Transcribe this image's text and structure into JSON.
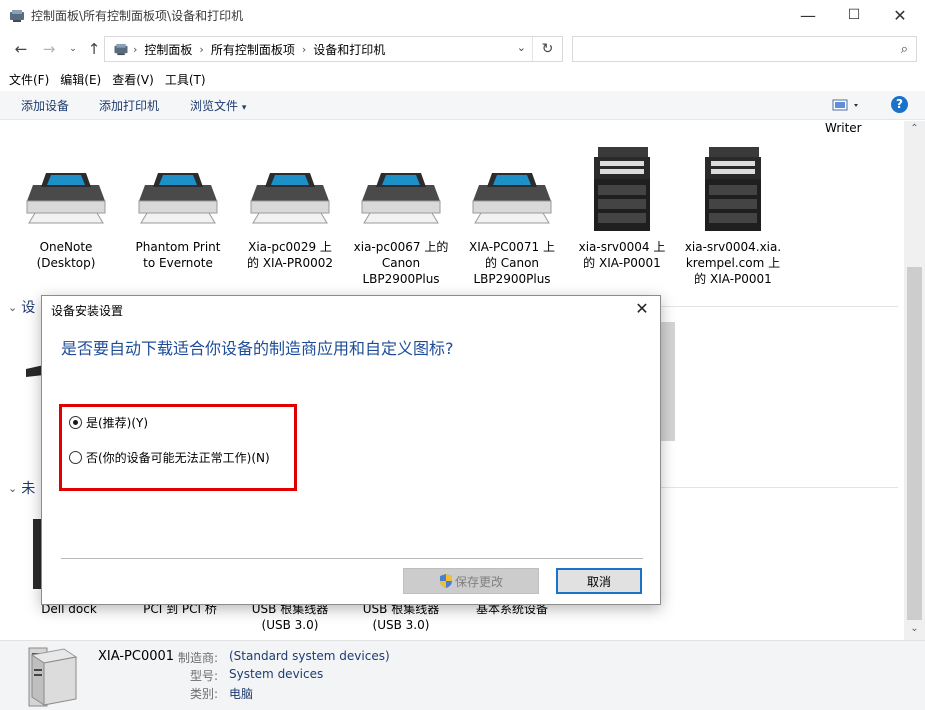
{
  "titlebar": {
    "title": "控制面板\\所有控制面板项\\设备和打印机",
    "minimize": "—",
    "maximize": "☐",
    "close": "✕"
  },
  "nav": {
    "breadcrumbs": [
      "控制面板",
      "所有控制面板项",
      "设备和打印机"
    ],
    "search_placeholder": ""
  },
  "menubar": [
    "文件(F)",
    "编辑(E)",
    "查看(V)",
    "工具(T)"
  ],
  "commandbar": {
    "add_device": "添加设备",
    "add_printer": "添加打印机",
    "browse_files": "浏览文件"
  },
  "content": {
    "partial_top_label": "Writer",
    "printers": [
      {
        "label": "OneNote\n(Desktop)",
        "icon": "printer-icon"
      },
      {
        "label": "Phantom Print\nto Evernote",
        "icon": "printer-icon"
      },
      {
        "label": "Xia-pc0029 上\n的 XIA-PR0002",
        "icon": "printer-icon"
      },
      {
        "label": "xia-pc0067 上的\nCanon\nLBP2900Plus",
        "icon": "printer-icon"
      },
      {
        "label": "XIA-PC0071 上\n的 Canon\nLBP2900Plus",
        "icon": "printer-icon"
      },
      {
        "label": "xia-srv0004 上\n的 XIA-P0001",
        "icon": "copier-icon"
      },
      {
        "label": "xia-srv0004.xia.\nkrempel.com 上\n的 XIA-P0001",
        "icon": "copier-icon"
      }
    ],
    "section1_partial": "设",
    "section2_partial": "未",
    "bottom_devices": [
      {
        "label": "Dell dock"
      },
      {
        "label": "PCI 到 PCI 桥"
      },
      {
        "label": "USB 根集线器\n(USB 3.0)"
      },
      {
        "label": "USB 根集线器\n(USB 3.0)"
      },
      {
        "label": "基本系统设备"
      }
    ]
  },
  "details": {
    "name": "XIA-PC0001",
    "manufacturer_key": "制造商:",
    "manufacturer_val": "(Standard system devices)",
    "model_key": "型号:",
    "model_val": "System devices",
    "category_key": "类别:",
    "category_val": "电脑"
  },
  "dialog": {
    "title": "设备安装设置",
    "question": "是否要自动下载适合你设备的制造商应用和自定义图标?",
    "option_yes": "是(推荐)(Y)",
    "option_no": "否(你的设备可能无法正常工作)(N)",
    "selected": "yes",
    "save_button": "保存更改",
    "cancel_button": "取消",
    "close": "✕"
  },
  "colors": {
    "accent": "#1a73c8",
    "highlight": "#e00000",
    "link": "#1e3b6f"
  }
}
